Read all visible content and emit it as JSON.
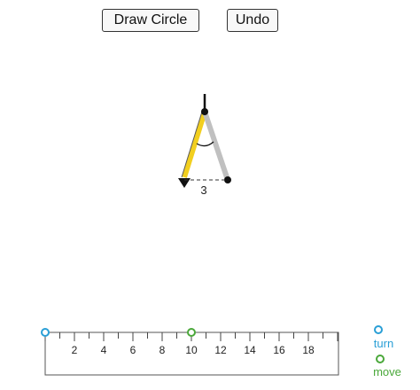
{
  "toolbar": {
    "draw_circle_label": "Draw Circle",
    "undo_label": "Undo"
  },
  "compass": {
    "radius_label": "3",
    "pencil_color": "#f2cf1f",
    "leg_color": "#c0c0c0"
  },
  "ruler": {
    "tick_labels": [
      "2",
      "4",
      "6",
      "8",
      "10",
      "12",
      "14",
      "16",
      "18"
    ]
  },
  "controls": {
    "turn_label": "turn",
    "move_label": "move",
    "turn_color": "#2a9fd6",
    "move_color": "#4aa83a"
  }
}
